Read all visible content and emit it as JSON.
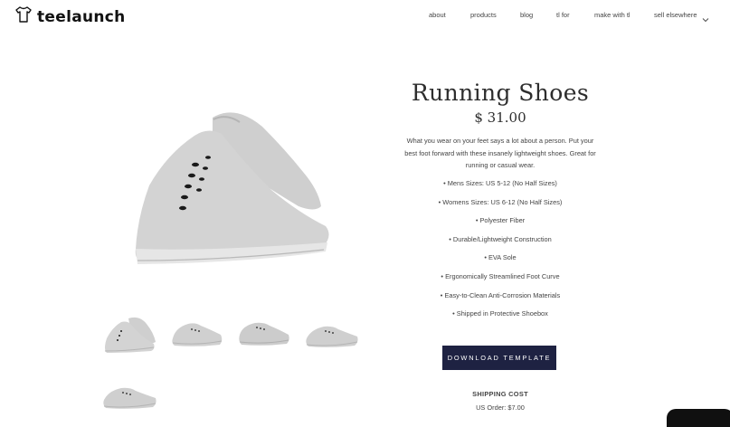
{
  "brand": {
    "name": "teelaunch"
  },
  "nav": {
    "items": [
      {
        "label": "about"
      },
      {
        "label": "products"
      },
      {
        "label": "blog"
      },
      {
        "label": "tl for"
      },
      {
        "label": "make with tl"
      },
      {
        "label": "sell elsewhere"
      }
    ]
  },
  "product": {
    "title": "Running Shoes",
    "price": "$ 31.00",
    "description": "What you wear on your feet says a lot about a person. Put your best foot forward with these insanely lightweight shoes. Great for running or casual wear.",
    "features": [
      "• Mens Sizes: US 5-12 (No Half Sizes)",
      "• Womens Sizes: US 6-12 (No Half Sizes)",
      "• Polyester Fiber",
      "• Durable/Lightweight Construction",
      "• EVA Sole",
      "• Ergonomically Streamlined Foot Curve",
      "• Easy-to-Clean Anti-Corrosion Materials",
      "• Shipped in Protective Shoebox"
    ],
    "download_label": "DOWNLOAD TEMPLATE",
    "shipping_label": "SHIPPING COST",
    "shipping_value": "US Order: $7.00"
  },
  "colors": {
    "button": "#1e2242",
    "shoe": "#c9c9c9",
    "shoe_shadow": "#a9a9a9"
  }
}
